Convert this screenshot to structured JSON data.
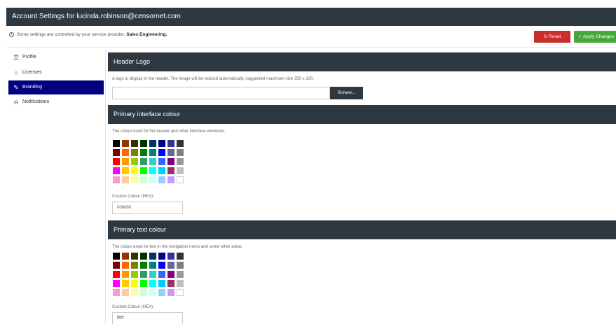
{
  "window": {
    "title": "Account Settings for lucinda.robinson@censornet.com"
  },
  "infobar": {
    "icon": "info-icon",
    "message_prefix": "Some settings are controlled by your service provider,",
    "provider": "Sales Engineering.",
    "reset_label": "Reset",
    "apply_label": "Apply Changes"
  },
  "sidebar": {
    "active_color": "#000080",
    "items": [
      {
        "label": "Profile",
        "icon": "sliders-icon"
      },
      {
        "label": "Licenses",
        "icon": "circle-icon"
      },
      {
        "label": "Branding",
        "icon": "brush-icon"
      },
      {
        "label": "Notifications",
        "icon": "bell-icon"
      }
    ]
  },
  "sections": {
    "header_logo": {
      "title": "Header Logo",
      "description": "A logo to display in the header. The image will be resized automatically, suggested maximum size 350 x 100.",
      "browse_label": "Browse..."
    },
    "primary_interface": {
      "title": "Primary interface colour",
      "description": "The colour used for the header and other interface elements.",
      "custom_label": "Custom Colour (HEX):",
      "custom_value": "000080"
    },
    "primary_text": {
      "title": "Primary text colour",
      "description": "The colour used for text in the navigation menu and some other areas",
      "custom_label": "Custom Colour (HEX):",
      "custom_value": "ffffff"
    }
  },
  "palette_colors": [
    "#000000",
    "#993300",
    "#333300",
    "#003300",
    "#003366",
    "#000080",
    "#333399",
    "#333333",
    "#800000",
    "#ff6600",
    "#808000",
    "#008000",
    "#008080",
    "#0000ff",
    "#666699",
    "#808080",
    "#ff0000",
    "#ff9900",
    "#99cc00",
    "#339966",
    "#33cccc",
    "#3366ff",
    "#800080",
    "#999999",
    "#ff00ff",
    "#ffcc00",
    "#ffff00",
    "#00ff00",
    "#00ffff",
    "#00ccff",
    "#993366",
    "#c0c0c0",
    "#ff99cc",
    "#ffcc99",
    "#ffff99",
    "#ccffcc",
    "#ccffff",
    "#99ccff",
    "#cc99ff",
    "#ffffff"
  ]
}
